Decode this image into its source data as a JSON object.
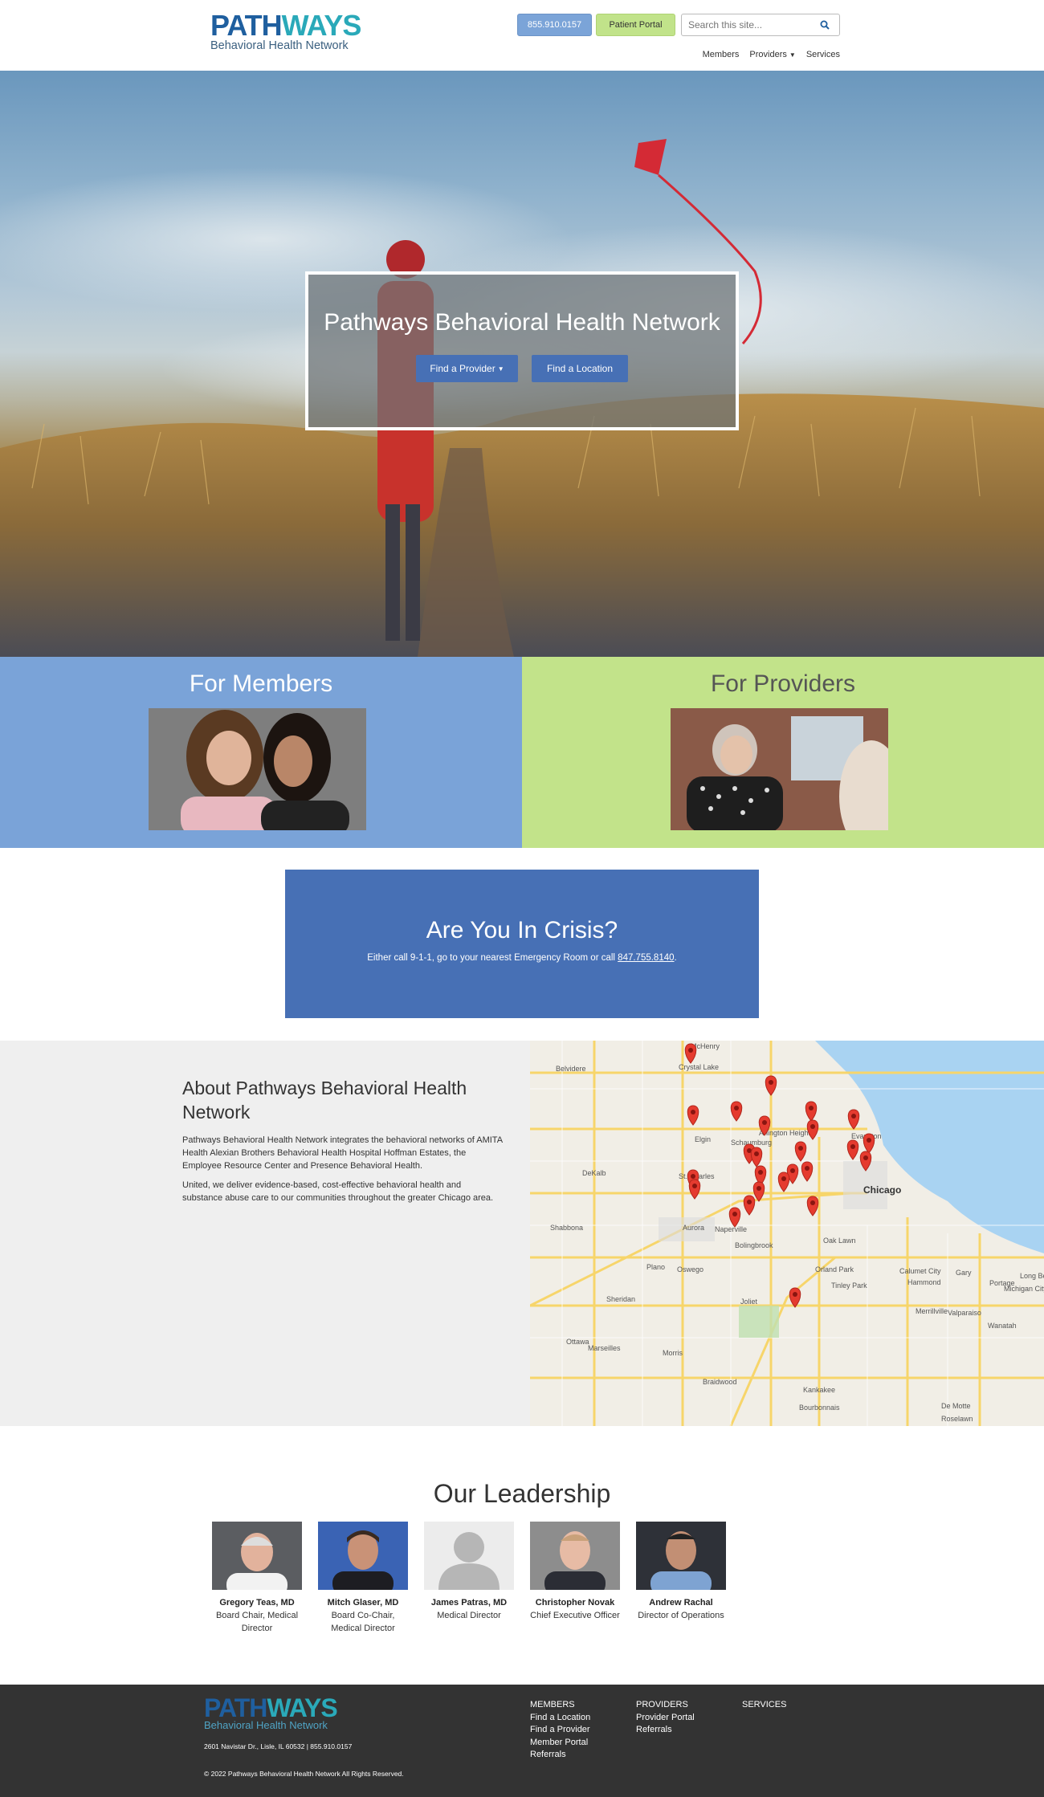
{
  "header": {
    "logo_path": "PATH",
    "logo_ways": "WAYS",
    "logo_sub": "Behavioral Health Network",
    "phone_label": "855.910.0157",
    "portal_label": "Patient Portal",
    "search_placeholder": "Search this site...",
    "nav": [
      "Members",
      "Providers",
      "Services"
    ]
  },
  "hero": {
    "title": "Pathways Behavioral Health Network",
    "find_provider": "Find a Provider",
    "find_location": "Find a Location"
  },
  "audience": {
    "members_title": "For Members",
    "providers_title": "For Providers"
  },
  "crisis": {
    "title": "Are You In Crisis?",
    "text_before": "Either call 9-1-1, go to your nearest Emergency Room or call ",
    "phone": "847.755.8140",
    "text_after": "."
  },
  "about": {
    "title": "About Pathways Behavioral Health Network",
    "p1": "Pathways Behavioral Health Network integrates the behavioral networks of AMITA Health Alexian Brothers Behavioral Health Hospital Hoffman Estates, the Employee Resource Center and Presence Behavioral Health.",
    "p2": "United, we deliver evidence-based, cost-effective behavioral health and substance abuse care to our communities throughout the greater Chicago area."
  },
  "map": {
    "labels": [
      "McHenry",
      "Crystal Lake",
      "Belvidere",
      "Arlington Heights",
      "Evanston",
      "Elgin",
      "Schaumburg",
      "DeKalb",
      "St. Charles",
      "Chicago",
      "Shabbona",
      "Aurora",
      "Naperville",
      "Bolingbrook",
      "Oak Lawn",
      "Plano",
      "Oswego",
      "Orland Park",
      "Calumet City",
      "Gary",
      "Hammond",
      "Portage",
      "Tinley Park",
      "Sheridan",
      "Joliet",
      "Merrillville",
      "Valparaiso",
      "Wanatah",
      "Ottawa",
      "Marseilles",
      "Morris",
      "Braidwood",
      "Kankakee",
      "Bourbonnais",
      "De Motte",
      "Roselawn",
      "Michigan City",
      "Long Be"
    ]
  },
  "leadership": {
    "title": "Our Leadership",
    "people": [
      {
        "name": "Gregory Teas, MD",
        "role": "Board Chair, Medical Director"
      },
      {
        "name": "Mitch Glaser, MD",
        "role": "Board Co-Chair, Medical Director"
      },
      {
        "name": "James Patras, MD",
        "role": "Medical Director"
      },
      {
        "name": "Christopher Novak",
        "role": "Chief Executive Officer"
      },
      {
        "name": "Andrew Rachal",
        "role": "Director of Operations"
      }
    ]
  },
  "footer": {
    "address": "2601 Navistar Dr., Lisle, IL 60532 | 855.910.0157",
    "copyright": "© 2022 Pathways Behavioral Health Network All Rights Reserved.",
    "members_head": "MEMBERS",
    "members_links": [
      "Find a Location",
      "Find a Provider",
      "Member Portal",
      "Referrals"
    ],
    "providers_head": "PROVIDERS",
    "providers_links": [
      "Provider Portal",
      "Referrals"
    ],
    "services_head": "SERVICES"
  },
  "colors": {
    "primary_blue": "#4770b5",
    "light_blue": "#7aa3d8",
    "light_green": "#c2e38a",
    "footer_bg": "#333333"
  }
}
